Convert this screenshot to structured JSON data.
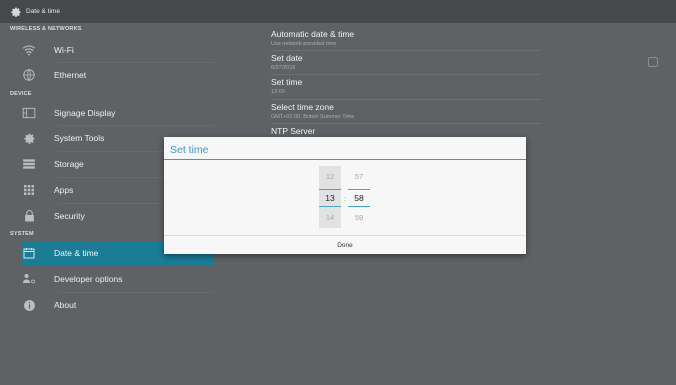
{
  "topbar": {
    "title": "Date & time",
    "icon": "gear-icon"
  },
  "sidebar": {
    "sections": {
      "wireless": "WIRELESS & NETWORKS",
      "device": "DEVICE",
      "system": "SYSTEM"
    },
    "items": [
      {
        "label": "Wi-Fi",
        "icon": "wifi-icon"
      },
      {
        "label": "Ethernet",
        "icon": "globe-icon"
      },
      {
        "label": "Signage Display",
        "icon": "display-icon"
      },
      {
        "label": "System Tools",
        "icon": "gear-icon"
      },
      {
        "label": "Storage",
        "icon": "storage-icon"
      },
      {
        "label": "Apps",
        "icon": "apps-icon"
      },
      {
        "label": "Security",
        "icon": "lock-icon"
      },
      {
        "label": "Date & time",
        "icon": "calendar-icon"
      },
      {
        "label": "Developer options",
        "icon": "developer-icon"
      },
      {
        "label": "About",
        "icon": "info-icon"
      }
    ],
    "active_index": 7
  },
  "settings": {
    "auto_time": {
      "title": "Automatic date & time",
      "subtitle": "Use network-provided time"
    },
    "set_date": {
      "title": "Set date",
      "subtitle": "6/27/2016"
    },
    "set_time": {
      "title": "Set time",
      "subtitle": "13:00"
    },
    "time_zone": {
      "title": "Select time zone",
      "subtitle": "GMT+01:00, British Summer Time"
    },
    "ntp": {
      "title": "NTP Server"
    }
  },
  "dialog": {
    "title": "Set time",
    "hours": {
      "prev": "12",
      "current": "13",
      "next": "14"
    },
    "minutes": {
      "prev": "57",
      "current": "58",
      "next": "59"
    },
    "separator": ":",
    "done_label": "Done"
  },
  "colors": {
    "accent": "#3a9cc3",
    "active_row": "#1a7c95",
    "background": "#5e6265"
  }
}
